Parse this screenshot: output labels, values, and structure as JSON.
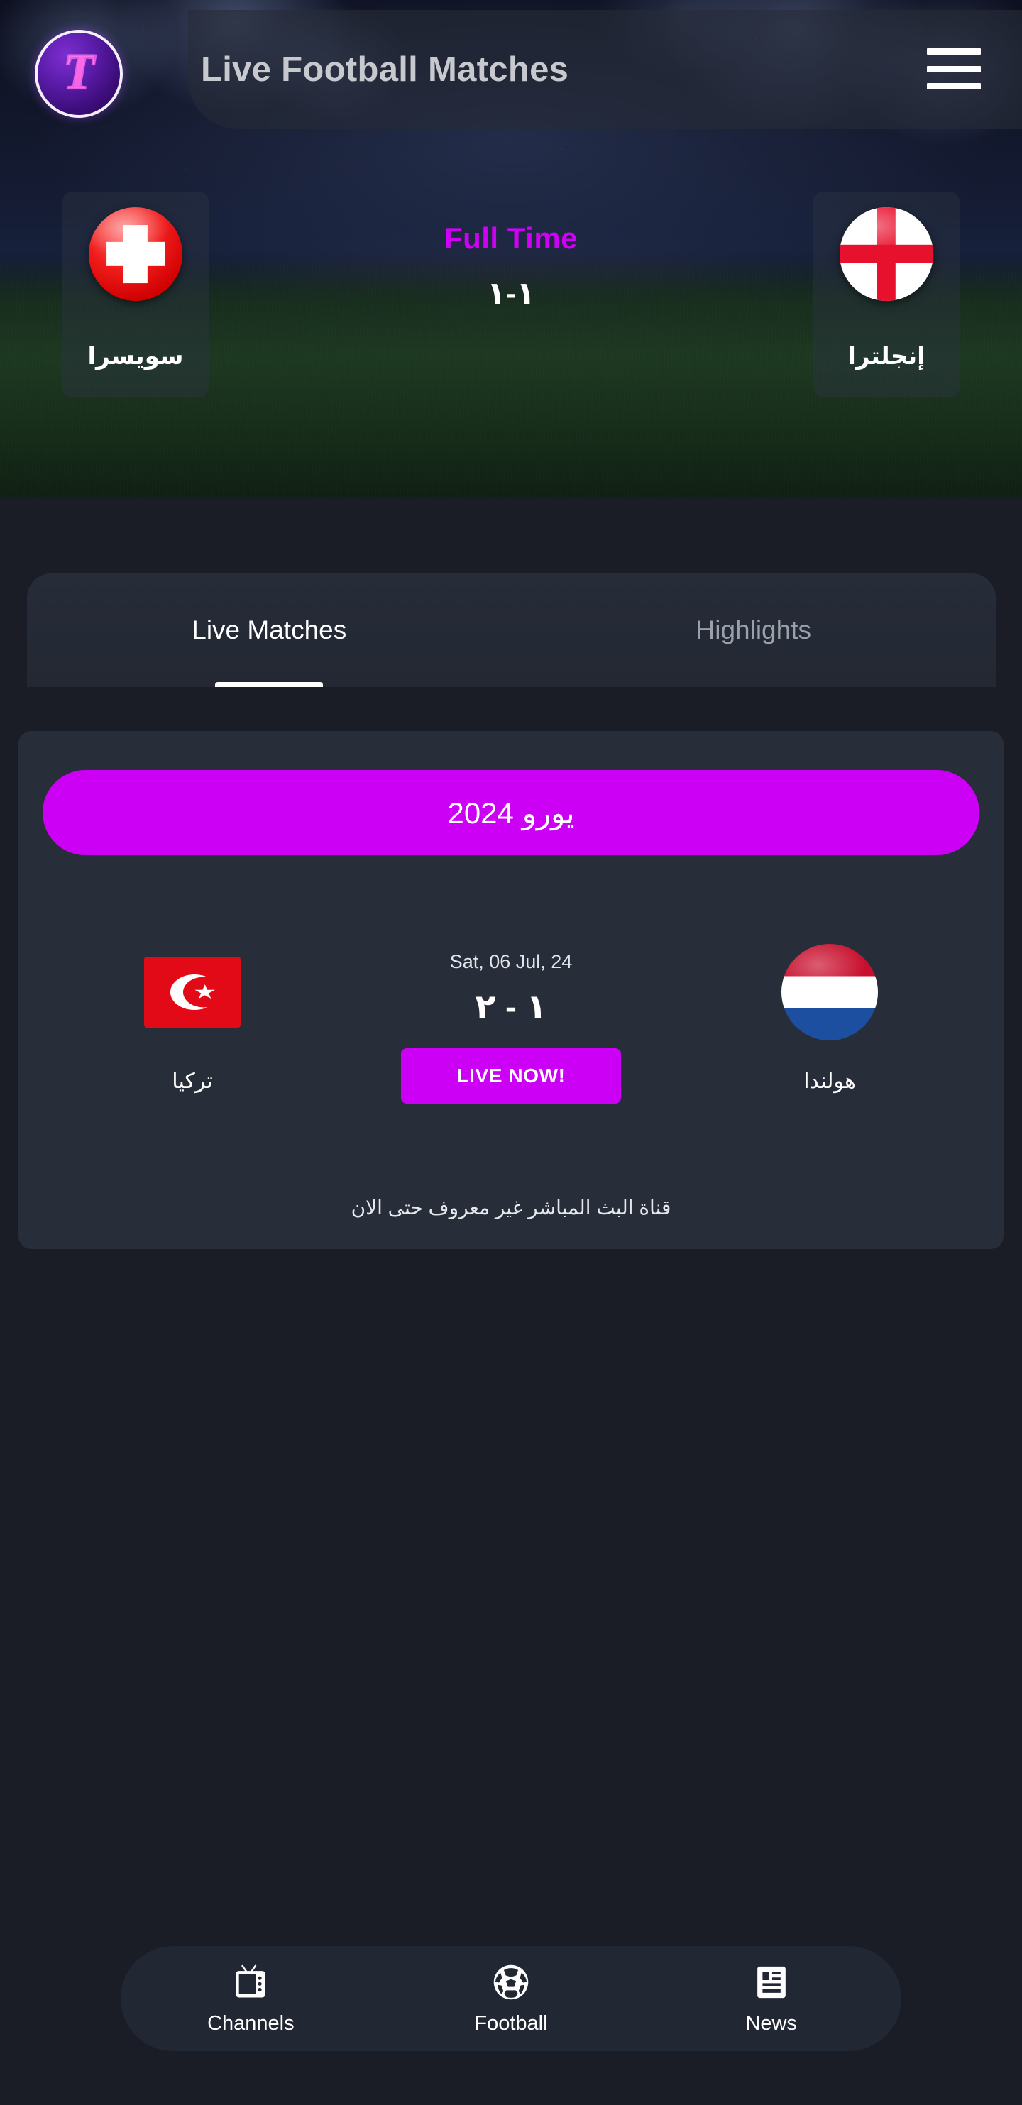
{
  "app": {
    "title": "Live Football Matches",
    "logo_letter": "T",
    "accent_color": "#cc00f5",
    "page_background": "#1a1d26",
    "card_background": "#272d39"
  },
  "header": {
    "title": "Live Football Matches",
    "menu_icon": "hamburger-menu-icon"
  },
  "hero_match": {
    "status": "Full Time",
    "score": "١-١",
    "home": {
      "name": "سويسرا",
      "flag": "switzerland-flag"
    },
    "away": {
      "name": "إنجلترا",
      "flag": "england-flag"
    }
  },
  "tabs": [
    {
      "label": "Live Matches",
      "active": true
    },
    {
      "label": "Highlights",
      "active": false
    }
  ],
  "match_card": {
    "league": "يورو 2024",
    "date": "Sat, 06 Jul, 24",
    "score": "١ - ٢",
    "live_button": "LIVE NOW!",
    "note": "قناة البث المباشر غير معروف حتى الان",
    "home": {
      "name": "تركيا",
      "flag": "turkey-flag"
    },
    "away": {
      "name": "هولندا",
      "flag": "netherlands-flag"
    }
  },
  "bottom_nav": [
    {
      "label": "Channels",
      "icon": "tv-icon"
    },
    {
      "label": "Football",
      "icon": "soccer-ball-icon"
    },
    {
      "label": "News",
      "icon": "newspaper-icon"
    }
  ]
}
